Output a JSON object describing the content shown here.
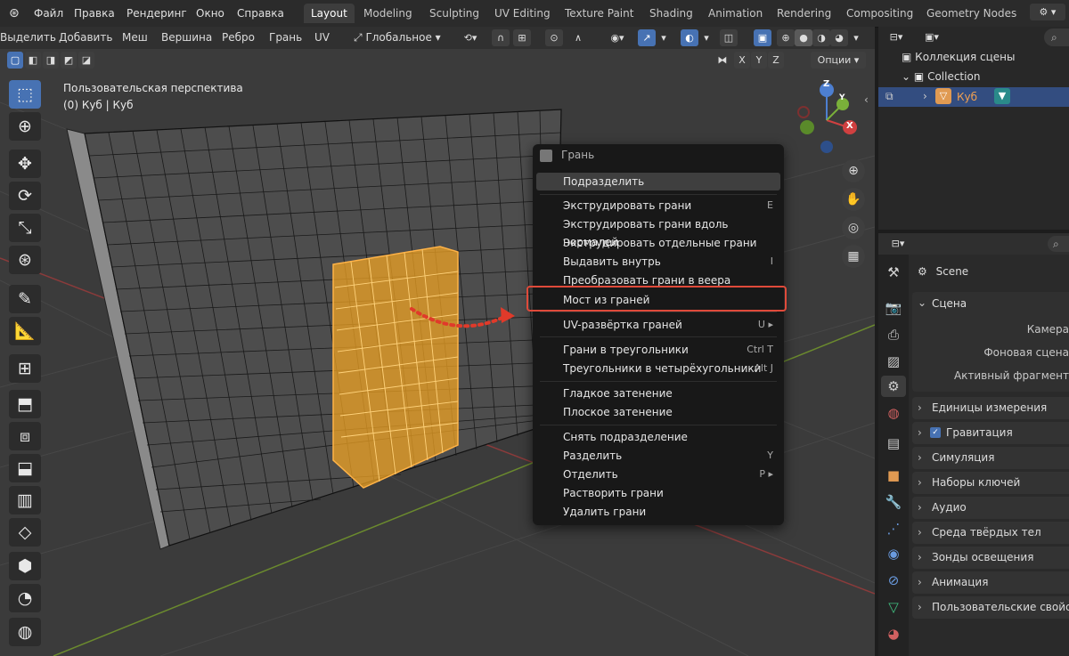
{
  "menubar": {
    "items": [
      "Файл",
      "Правка",
      "Рендеринг",
      "Окно",
      "Справка"
    ],
    "workspaces": [
      "Layout",
      "Modeling",
      "Sculpting",
      "UV Editing",
      "Texture Paint",
      "Shading",
      "Animation",
      "Rendering",
      "Compositing",
      "Geometry Nodes"
    ],
    "active_workspace": "Layout"
  },
  "header": {
    "menus": [
      "Выделить",
      "Добавить",
      "Меш",
      "Вершина",
      "Ребро",
      "Грань",
      "UV"
    ],
    "orientation": "Глобальное",
    "axes": [
      "X",
      "Y",
      "Z"
    ],
    "options": "Опции"
  },
  "viewport": {
    "view_name": "Пользовательская перспектива",
    "object_info": "(0) Куб | Куб",
    "gizmo": {
      "z": "Z",
      "y": "Y",
      "x": "X"
    }
  },
  "context_menu": {
    "title": "Грань",
    "items": [
      {
        "label": "Подразделить",
        "shortcut": ""
      },
      {
        "label": "Экструдировать грани",
        "shortcut": "E"
      },
      {
        "label": "Экструдировать грани вдоль нормалей",
        "shortcut": ""
      },
      {
        "label": "Экструдировать отдельные грани",
        "shortcut": ""
      },
      {
        "label": "Выдавить внутрь",
        "shortcut": "I"
      },
      {
        "label": "Преобразовать грани в веера",
        "shortcut": ""
      },
      {
        "label": "Мост из граней",
        "shortcut": ""
      },
      {
        "label": "UV-развёртка граней",
        "shortcut": "U ▸"
      },
      {
        "label": "Грани в треугольники",
        "shortcut": "Ctrl T"
      },
      {
        "label": "Треугольники в четырёхугольники",
        "shortcut": "Alt J"
      },
      {
        "label": "Гладкое затенение",
        "shortcut": ""
      },
      {
        "label": "Плоское затенение",
        "shortcut": ""
      },
      {
        "label": "Снять подразделение",
        "shortcut": ""
      },
      {
        "label": "Разделить",
        "shortcut": "Y"
      },
      {
        "label": "Отделить",
        "shortcut": "P ▸"
      },
      {
        "label": "Растворить грани",
        "shortcut": ""
      },
      {
        "label": "Удалить грани",
        "shortcut": ""
      }
    ],
    "highlighted": "Мост из граней"
  },
  "outliner": {
    "scene_collection": "Коллекция сцены",
    "collection": "Collection",
    "object": "Куб"
  },
  "properties": {
    "scene_name": "Scene",
    "panel_title": "Сцена",
    "fields": [
      "Камера",
      "Фоновая сцена",
      "Активный фрагмент"
    ],
    "sections": [
      "Единицы измерения",
      "Гравитация",
      "Симуляция",
      "Наборы ключей",
      "Аудио",
      "Среда твёрдых тел",
      "Зонды освещения",
      "Анимация",
      "Пользовательские свойства"
    ]
  },
  "colors": {
    "accent": "#4772b3",
    "selection": "#f5a623",
    "highlight_frame": "#e04a3a"
  }
}
